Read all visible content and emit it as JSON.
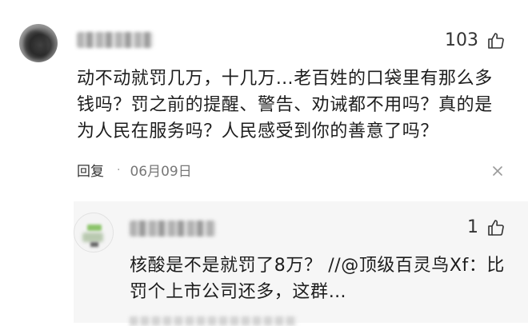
{
  "comment": {
    "username": "",
    "likes": "103",
    "text": "动不动就罚几万，十几万…老百姓的口袋里有那么多钱吗？罚之前的提醒、警告、劝诫都不用吗？真的是为人民在服务吗？人民感受到你的善意了吗？",
    "reply_label": "回复",
    "separator": "·",
    "date": "06月09日"
  },
  "reply": {
    "username": "",
    "likes": "1",
    "text": "核酸是不是就罚了8万？ //@顶级百灵鸟Xf：比罚个上市公司还多，这群…"
  }
}
